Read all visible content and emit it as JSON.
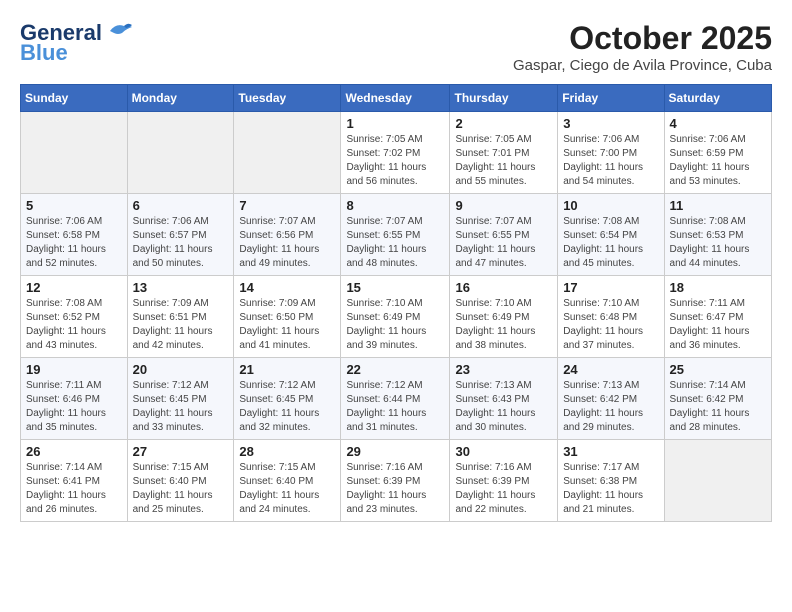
{
  "header": {
    "logo_general": "General",
    "logo_blue": "Blue",
    "month": "October 2025",
    "location": "Gaspar, Ciego de Avila Province, Cuba"
  },
  "weekdays": [
    "Sunday",
    "Monday",
    "Tuesday",
    "Wednesday",
    "Thursday",
    "Friday",
    "Saturday"
  ],
  "weeks": [
    [
      {
        "day": "",
        "sunrise": "",
        "sunset": "",
        "daylight": ""
      },
      {
        "day": "",
        "sunrise": "",
        "sunset": "",
        "daylight": ""
      },
      {
        "day": "",
        "sunrise": "",
        "sunset": "",
        "daylight": ""
      },
      {
        "day": "1",
        "sunrise": "Sunrise: 7:05 AM",
        "sunset": "Sunset: 7:02 PM",
        "daylight": "Daylight: 11 hours and 56 minutes."
      },
      {
        "day": "2",
        "sunrise": "Sunrise: 7:05 AM",
        "sunset": "Sunset: 7:01 PM",
        "daylight": "Daylight: 11 hours and 55 minutes."
      },
      {
        "day": "3",
        "sunrise": "Sunrise: 7:06 AM",
        "sunset": "Sunset: 7:00 PM",
        "daylight": "Daylight: 11 hours and 54 minutes."
      },
      {
        "day": "4",
        "sunrise": "Sunrise: 7:06 AM",
        "sunset": "Sunset: 6:59 PM",
        "daylight": "Daylight: 11 hours and 53 minutes."
      }
    ],
    [
      {
        "day": "5",
        "sunrise": "Sunrise: 7:06 AM",
        "sunset": "Sunset: 6:58 PM",
        "daylight": "Daylight: 11 hours and 52 minutes."
      },
      {
        "day": "6",
        "sunrise": "Sunrise: 7:06 AM",
        "sunset": "Sunset: 6:57 PM",
        "daylight": "Daylight: 11 hours and 50 minutes."
      },
      {
        "day": "7",
        "sunrise": "Sunrise: 7:07 AM",
        "sunset": "Sunset: 6:56 PM",
        "daylight": "Daylight: 11 hours and 49 minutes."
      },
      {
        "day": "8",
        "sunrise": "Sunrise: 7:07 AM",
        "sunset": "Sunset: 6:55 PM",
        "daylight": "Daylight: 11 hours and 48 minutes."
      },
      {
        "day": "9",
        "sunrise": "Sunrise: 7:07 AM",
        "sunset": "Sunset: 6:55 PM",
        "daylight": "Daylight: 11 hours and 47 minutes."
      },
      {
        "day": "10",
        "sunrise": "Sunrise: 7:08 AM",
        "sunset": "Sunset: 6:54 PM",
        "daylight": "Daylight: 11 hours and 45 minutes."
      },
      {
        "day": "11",
        "sunrise": "Sunrise: 7:08 AM",
        "sunset": "Sunset: 6:53 PM",
        "daylight": "Daylight: 11 hours and 44 minutes."
      }
    ],
    [
      {
        "day": "12",
        "sunrise": "Sunrise: 7:08 AM",
        "sunset": "Sunset: 6:52 PM",
        "daylight": "Daylight: 11 hours and 43 minutes."
      },
      {
        "day": "13",
        "sunrise": "Sunrise: 7:09 AM",
        "sunset": "Sunset: 6:51 PM",
        "daylight": "Daylight: 11 hours and 42 minutes."
      },
      {
        "day": "14",
        "sunrise": "Sunrise: 7:09 AM",
        "sunset": "Sunset: 6:50 PM",
        "daylight": "Daylight: 11 hours and 41 minutes."
      },
      {
        "day": "15",
        "sunrise": "Sunrise: 7:10 AM",
        "sunset": "Sunset: 6:49 PM",
        "daylight": "Daylight: 11 hours and 39 minutes."
      },
      {
        "day": "16",
        "sunrise": "Sunrise: 7:10 AM",
        "sunset": "Sunset: 6:49 PM",
        "daylight": "Daylight: 11 hours and 38 minutes."
      },
      {
        "day": "17",
        "sunrise": "Sunrise: 7:10 AM",
        "sunset": "Sunset: 6:48 PM",
        "daylight": "Daylight: 11 hours and 37 minutes."
      },
      {
        "day": "18",
        "sunrise": "Sunrise: 7:11 AM",
        "sunset": "Sunset: 6:47 PM",
        "daylight": "Daylight: 11 hours and 36 minutes."
      }
    ],
    [
      {
        "day": "19",
        "sunrise": "Sunrise: 7:11 AM",
        "sunset": "Sunset: 6:46 PM",
        "daylight": "Daylight: 11 hours and 35 minutes."
      },
      {
        "day": "20",
        "sunrise": "Sunrise: 7:12 AM",
        "sunset": "Sunset: 6:45 PM",
        "daylight": "Daylight: 11 hours and 33 minutes."
      },
      {
        "day": "21",
        "sunrise": "Sunrise: 7:12 AM",
        "sunset": "Sunset: 6:45 PM",
        "daylight": "Daylight: 11 hours and 32 minutes."
      },
      {
        "day": "22",
        "sunrise": "Sunrise: 7:12 AM",
        "sunset": "Sunset: 6:44 PM",
        "daylight": "Daylight: 11 hours and 31 minutes."
      },
      {
        "day": "23",
        "sunrise": "Sunrise: 7:13 AM",
        "sunset": "Sunset: 6:43 PM",
        "daylight": "Daylight: 11 hours and 30 minutes."
      },
      {
        "day": "24",
        "sunrise": "Sunrise: 7:13 AM",
        "sunset": "Sunset: 6:42 PM",
        "daylight": "Daylight: 11 hours and 29 minutes."
      },
      {
        "day": "25",
        "sunrise": "Sunrise: 7:14 AM",
        "sunset": "Sunset: 6:42 PM",
        "daylight": "Daylight: 11 hours and 28 minutes."
      }
    ],
    [
      {
        "day": "26",
        "sunrise": "Sunrise: 7:14 AM",
        "sunset": "Sunset: 6:41 PM",
        "daylight": "Daylight: 11 hours and 26 minutes."
      },
      {
        "day": "27",
        "sunrise": "Sunrise: 7:15 AM",
        "sunset": "Sunset: 6:40 PM",
        "daylight": "Daylight: 11 hours and 25 minutes."
      },
      {
        "day": "28",
        "sunrise": "Sunrise: 7:15 AM",
        "sunset": "Sunset: 6:40 PM",
        "daylight": "Daylight: 11 hours and 24 minutes."
      },
      {
        "day": "29",
        "sunrise": "Sunrise: 7:16 AM",
        "sunset": "Sunset: 6:39 PM",
        "daylight": "Daylight: 11 hours and 23 minutes."
      },
      {
        "day": "30",
        "sunrise": "Sunrise: 7:16 AM",
        "sunset": "Sunset: 6:39 PM",
        "daylight": "Daylight: 11 hours and 22 minutes."
      },
      {
        "day": "31",
        "sunrise": "Sunrise: 7:17 AM",
        "sunset": "Sunset: 6:38 PM",
        "daylight": "Daylight: 11 hours and 21 minutes."
      },
      {
        "day": "",
        "sunrise": "",
        "sunset": "",
        "daylight": ""
      }
    ]
  ]
}
